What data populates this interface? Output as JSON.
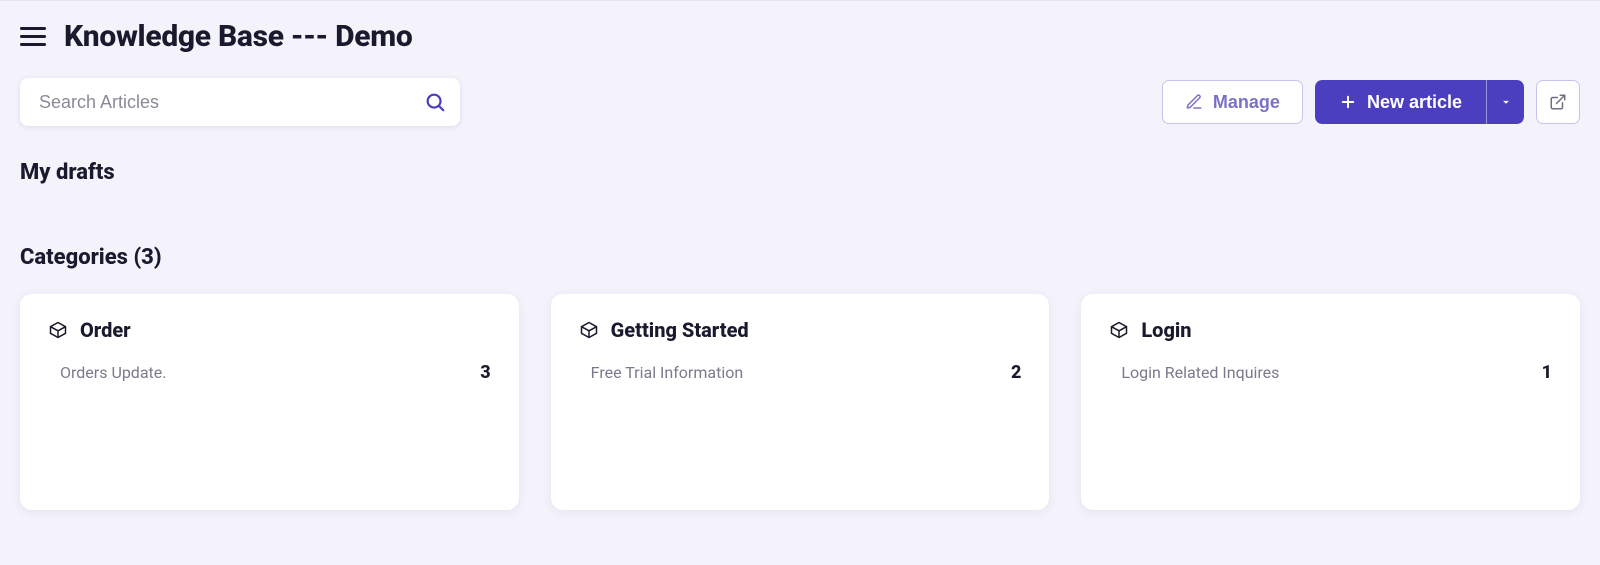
{
  "header": {
    "title": "Knowledge Base --- Demo"
  },
  "search": {
    "placeholder": "Search Articles"
  },
  "actions": {
    "manage": "Manage",
    "new_article": "New article"
  },
  "drafts": {
    "heading": "My drafts"
  },
  "categories": {
    "heading": "Categories (3)",
    "items": [
      {
        "title": "Order",
        "description": "Orders Update.",
        "count": "3"
      },
      {
        "title": "Getting Started",
        "description": "Free Trial Information",
        "count": "2"
      },
      {
        "title": "Login",
        "description": "Login Related Inquires",
        "count": "1"
      }
    ]
  }
}
